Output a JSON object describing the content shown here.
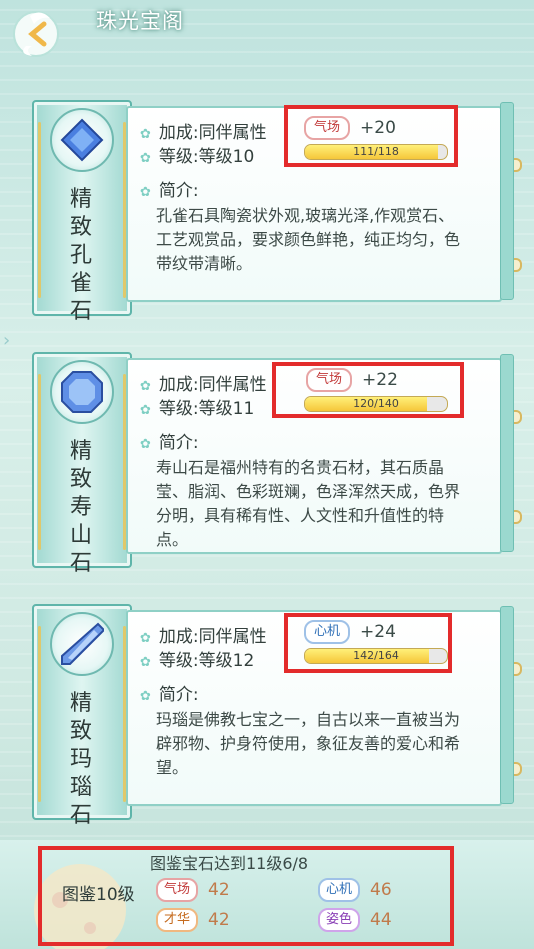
{
  "header": {
    "title": "珠光宝阁"
  },
  "cards": [
    {
      "name": "精致孔雀石",
      "bonus_label": "加成:同伴属性",
      "level_label": "等级:等级10",
      "attr_name": "气场",
      "attr_value": "+20",
      "progress_text": "111/118",
      "progress_ratio": 0.94,
      "intro_label": "简介:",
      "description": "孔雀石具陶瓷状外观,玻璃光泽,作观赏石、工艺观赏品，要求颜色鲜艳，纯正均匀，色带纹带清晰。"
    },
    {
      "name": "精致寿山石",
      "bonus_label": "加成:同伴属性",
      "level_label": "等级:等级11",
      "attr_name": "气场",
      "attr_value": "+22",
      "progress_text": "120/140",
      "progress_ratio": 0.857,
      "intro_label": "简介:",
      "description": "寿山石是福州特有的名贵石材，其石质晶莹、脂润、色彩斑斓，色泽浑然天成，色界分明，具有稀有性、人文性和升值性的特点。"
    },
    {
      "name": "精致玛瑙石",
      "bonus_label": "加成:同伴属性",
      "level_label": "等级:等级12",
      "attr_name": "心机",
      "attr_value": "+24",
      "progress_text": "142/164",
      "progress_ratio": 0.866,
      "intro_label": "简介:",
      "description": "玛瑙是佛教七宝之一，自古以来一直被当为辟邪物、护身符使用，象征友善的爱心和希望。"
    }
  ],
  "footer": {
    "title": "图鉴宝石达到11级6/8",
    "level": "图鉴10级",
    "stats": [
      {
        "name": "气场",
        "value": "42"
      },
      {
        "name": "心机",
        "value": "46"
      },
      {
        "name": "才华",
        "value": "42"
      },
      {
        "name": "姿色",
        "value": "44"
      }
    ]
  },
  "colors": {
    "highlight_box": "#e32b2b",
    "accent": "#8fd0c6"
  }
}
